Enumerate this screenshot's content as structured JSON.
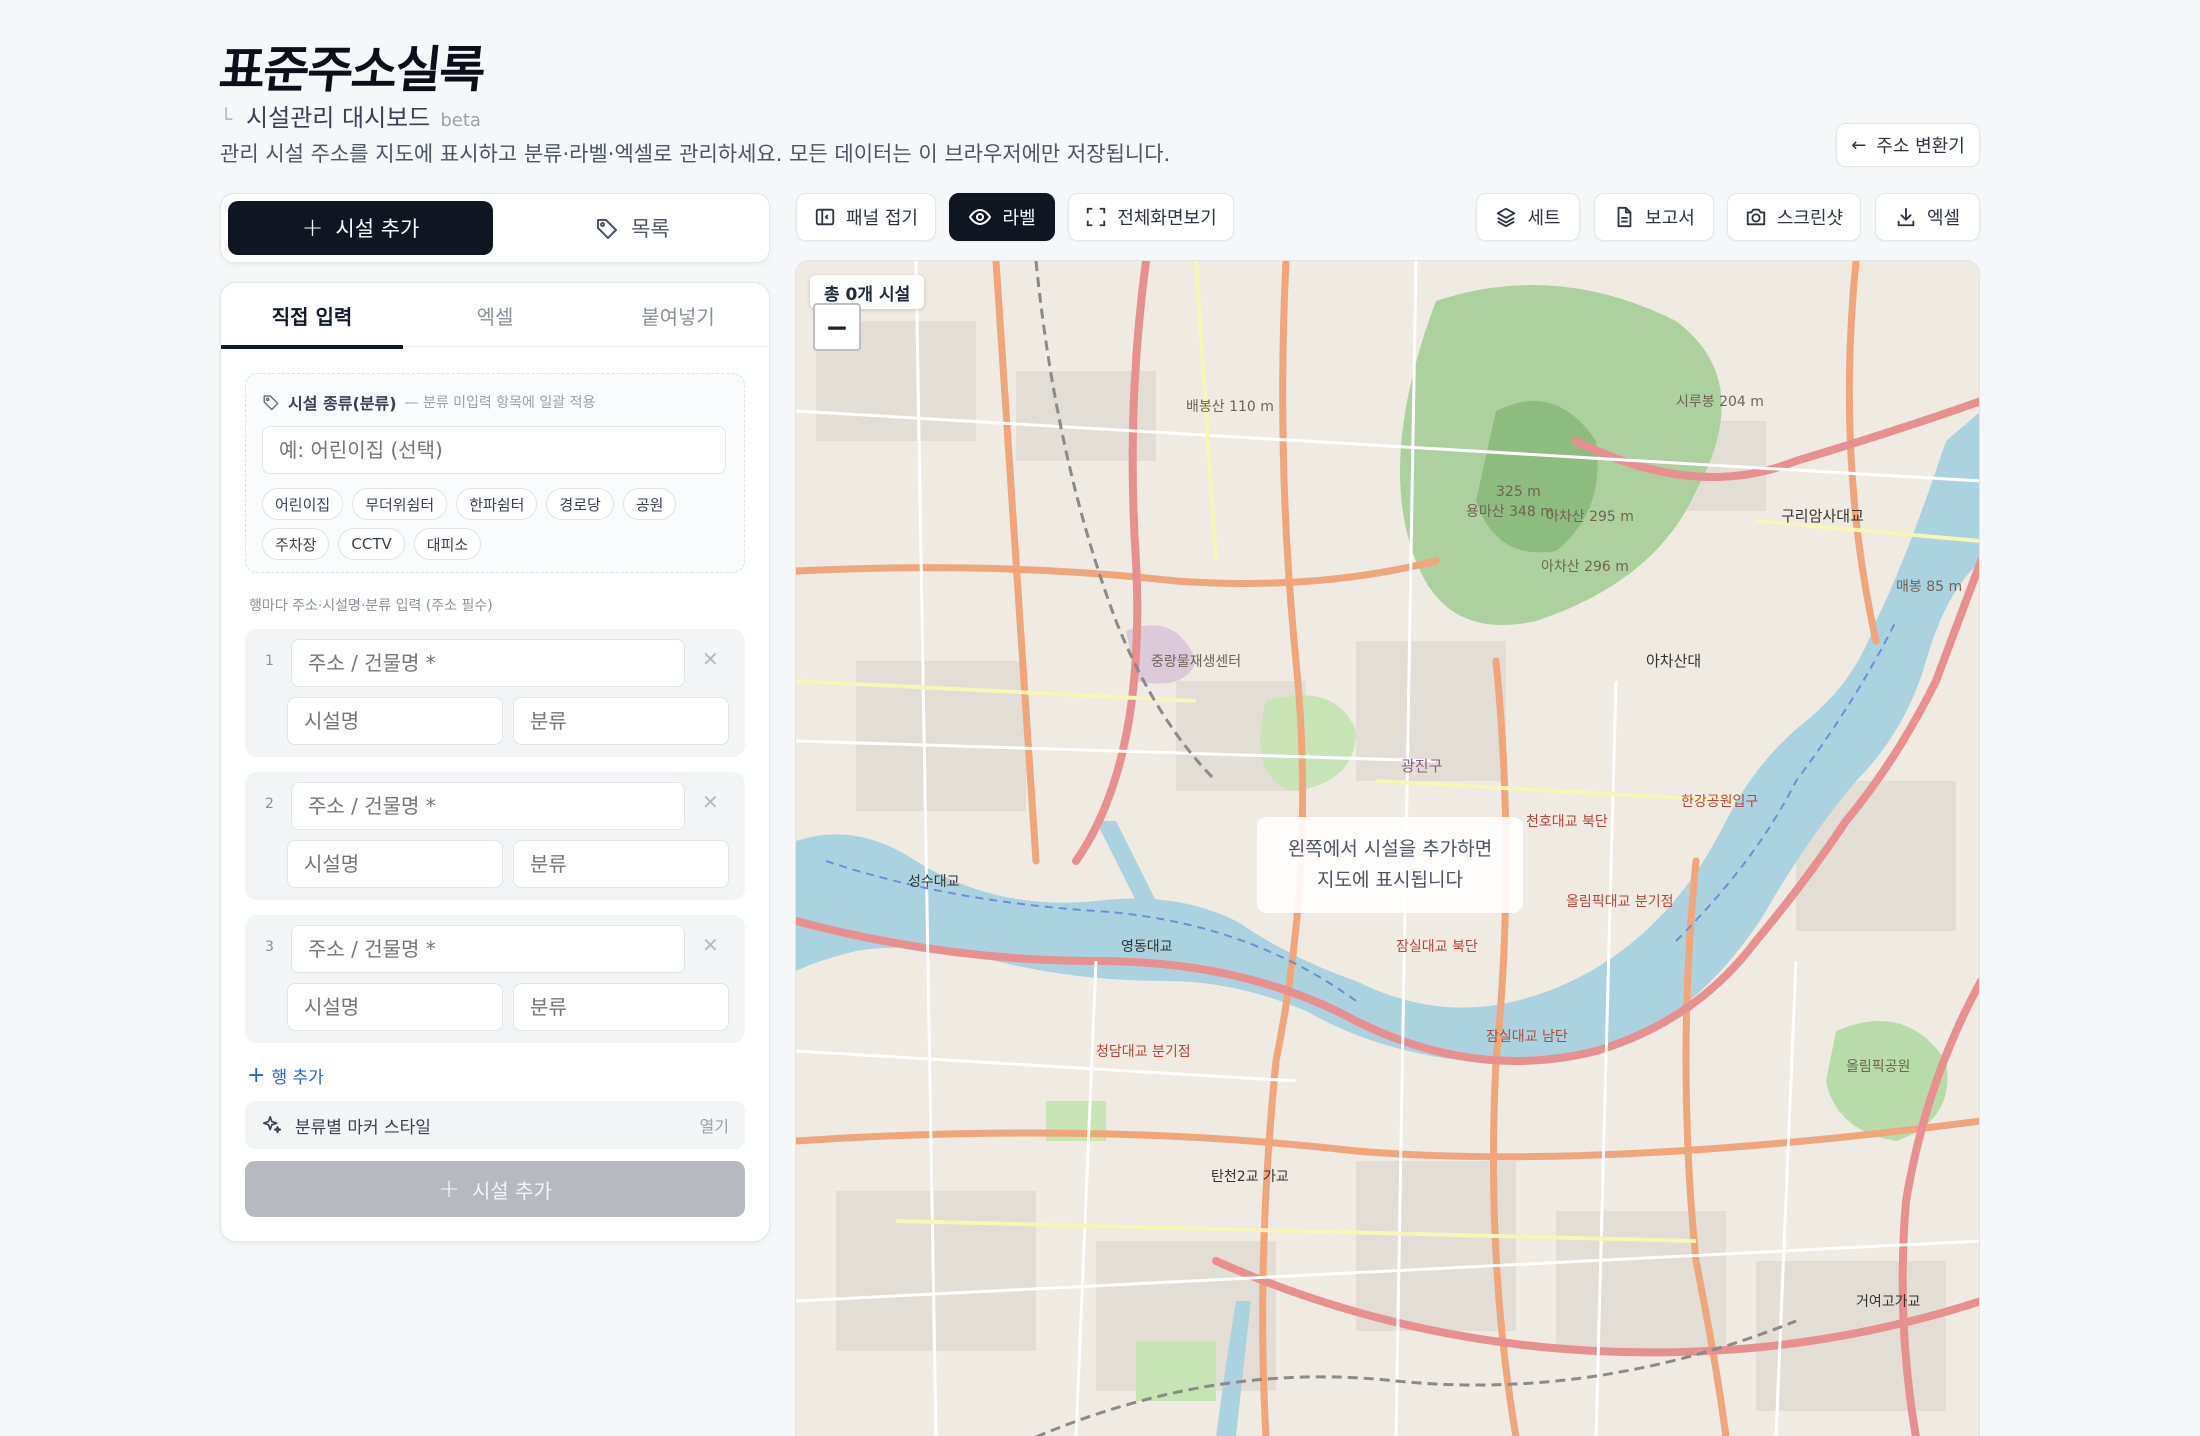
{
  "header": {
    "brand": "표준주소실록",
    "subtitle": "시설관리 대시보드",
    "badge": "beta",
    "description": "관리 시설 주소를 지도에 표시하고 분류·라벨·엑셀로 관리하세요. 모든 데이터는 이 브라우저에만 저장됩니다.",
    "converter_button": "주소 변환기"
  },
  "switcher": {
    "add_label": "시설 추가",
    "list_label": "목록"
  },
  "tabs": [
    {
      "label": "직접 입력"
    },
    {
      "label": "엑셀"
    },
    {
      "label": "붙여넣기"
    }
  ],
  "category": {
    "label": "시설 종류(분류)",
    "hint": "— 분류 미입력 항목에 일괄 적용",
    "placeholder": "예: 어린이집 (선택)",
    "chips": [
      "어린이집",
      "무더위쉼터",
      "한파쉼터",
      "경로당",
      "공원",
      "주차장",
      "CCTV",
      "대피소"
    ]
  },
  "rows": {
    "hint": "행마다 주소·시설명·분류 입력 (주소 필수)",
    "items": [
      {
        "num": "1",
        "addr_ph": "주소 / 건물명 *",
        "name_ph": "시설명",
        "cls_ph": "분류"
      },
      {
        "num": "2",
        "addr_ph": "주소 / 건물명 *",
        "name_ph": "시설명",
        "cls_ph": "분류"
      },
      {
        "num": "3",
        "addr_ph": "주소 / 건물명 *",
        "name_ph": "시설명",
        "cls_ph": "분류"
      }
    ],
    "add_row": "행 추가"
  },
  "marker_style": {
    "label": "분류별 마커 스타일",
    "action": "열기"
  },
  "submit_label": "시설 추가",
  "toolbar": {
    "fold": "패널 접기",
    "label": "라벨",
    "fullscreen": "전체화면보기",
    "set": "세트",
    "report": "보고서",
    "screenshot": "스크린샷",
    "excel": "엑셀"
  },
  "map": {
    "count": "총 0개 시설",
    "zoom_out": "−",
    "empty_line1": "왼쪽에서 시설을 추가하면",
    "empty_line2": "지도에 표시됩니다",
    "labels": [
      "배봉산 110 m",
      "용마산 348 m",
      "아차산 295 m",
      "아차산 296 m",
      "아차산대",
      "구리암사대교",
      "중랑물재생센터",
      "광진구",
      "성수대교",
      "영동대교",
      "청담대교 분기점",
      "잠실대교 북단",
      "천호대교 북단",
      "올림픽대교 분기점",
      "잠실대교 남단",
      "올림픽공원",
      "탄천2교 가교",
      "거여고가교",
      "한강공원입구",
      "시루봉 204 m",
      "325 m",
      "매봉 85 m"
    ]
  }
}
